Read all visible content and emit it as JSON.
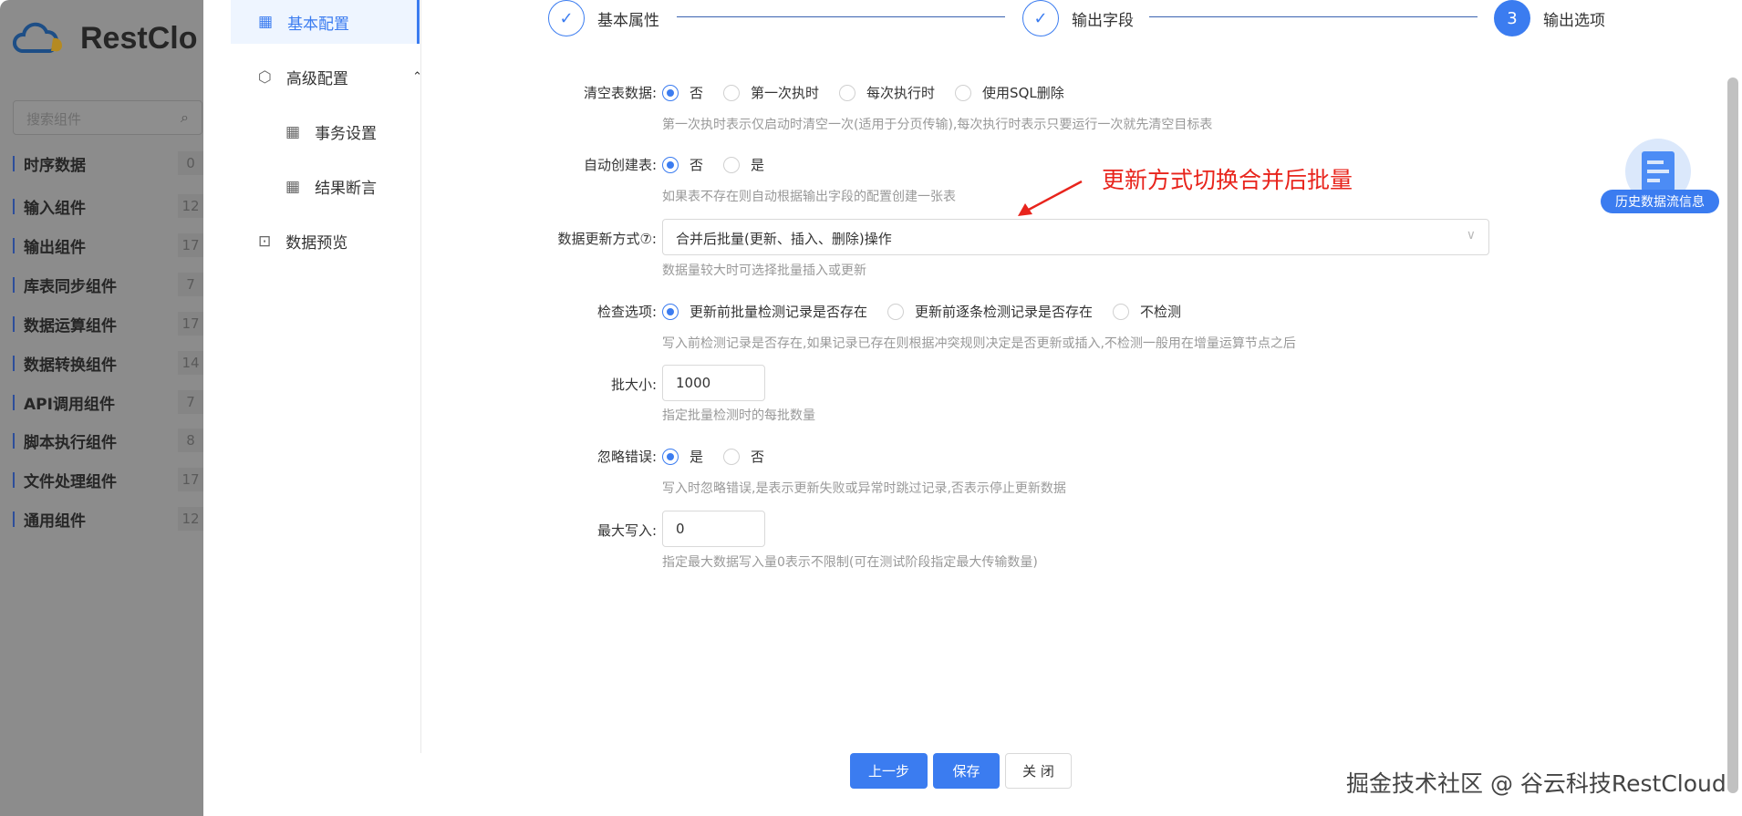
{
  "left_panel": {
    "logo_text": "RestClo",
    "search_placeholder": "搜索组件",
    "categories": [
      {
        "label": "时序数据",
        "count": "0"
      },
      {
        "label": "输入组件",
        "count": "12"
      },
      {
        "label": "输出组件",
        "count": "17"
      },
      {
        "label": "库表同步组件",
        "count": "7"
      },
      {
        "label": "数据运算组件",
        "count": "17"
      },
      {
        "label": "数据转换组件",
        "count": "14"
      },
      {
        "label": "API调用组件",
        "count": "7"
      },
      {
        "label": "脚本执行组件",
        "count": "8"
      },
      {
        "label": "文件处理组件",
        "count": "17"
      },
      {
        "label": "通用组件",
        "count": "12"
      }
    ]
  },
  "nav": {
    "basic": "基本配置",
    "advanced": "高级配置",
    "transaction": "事务设置",
    "assertion": "结果断言",
    "preview": "数据预览"
  },
  "steps": [
    {
      "label": "基本属性",
      "mark": "✓"
    },
    {
      "label": "输出字段",
      "mark": "✓"
    },
    {
      "label": "输出选项",
      "mark": "3"
    }
  ],
  "form": {
    "clear": {
      "label": "清空表数据:",
      "options": [
        "否",
        "第一次执时",
        "每次执行时",
        "使用SQL删除"
      ],
      "hint": "第一次执时表示仅启动时清空一次(适用于分页传输),每次执行时表示只要运行一次就先清空目标表"
    },
    "auto_create": {
      "label": "自动创建表:",
      "options": [
        "否",
        "是"
      ],
      "hint": "如果表不存在则自动根据输出字段的配置创建一张表"
    },
    "update_mode": {
      "label": "数据更新方式⑦:",
      "value": "合并后批量(更新、插入、删除)操作",
      "hint": "数据量较大时可选择批量插入或更新"
    },
    "check": {
      "label": "检查选项:",
      "options": [
        "更新前批量检测记录是否存在",
        "更新前逐条检测记录是否存在",
        "不检测"
      ],
      "hint": "写入前检测记录是否存在,如果记录已存在则根据冲突规则决定是否更新或插入,不检测一般用在增量运算节点之后"
    },
    "batch": {
      "label": "批大小:",
      "value": "1000",
      "hint": "指定批量检测时的每批数量"
    },
    "ignore": {
      "label": "忽略错误:",
      "options": [
        "是",
        "否"
      ],
      "hint": "写入时忽略错误,是表示更新失败或异常时跳过记录,否表示停止更新数据"
    },
    "max_write": {
      "label": "最大写入:",
      "value": "0",
      "hint": "指定最大数据写入量0表示不限制(可在测试阶段指定最大传输数量)"
    }
  },
  "buttons": {
    "prev": "上一步",
    "save": "保存",
    "close": "关 闭"
  },
  "annotation": "更新方式切换合并后批量",
  "history": "历史数据流信息",
  "watermark": "掘金技术社区 @ 谷云科技RestCloud",
  "colors": {
    "primary": "#3b7cf0",
    "annotation": "#e8241c"
  }
}
